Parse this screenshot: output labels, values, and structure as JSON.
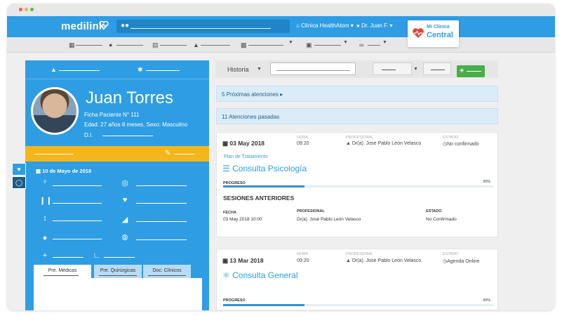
{
  "app": {
    "logo": "medilink",
    "clinic": "Clínica HealthAtom",
    "doctor": "Dr. Juan F.",
    "brand_line1": "Mi Clínica",
    "brand_line2": "Central"
  },
  "colors": {
    "primary": "#2e9de3",
    "warning": "#f5b61b",
    "success": "#49ad48",
    "banner": "#d9ecf8",
    "progress": "#3b8ed0"
  },
  "toolbar_icons": [
    "calendar-icon",
    "users-icon",
    "cart-icon",
    "user-md-icon",
    "documents-icon",
    "chart-icon",
    "link-icon"
  ],
  "patient": {
    "name": "Juan Torres",
    "ficha": "Ficha Paciente N° 111",
    "edad": "Edad: 27 años 8 meses, Sexo: Masculino",
    "di": "D.I.",
    "vitals_date": "10 de Mayo de 2018"
  },
  "left_tabs": {
    "medicas": "Pre. Médicas",
    "quirurgicas": "Pre. Quirúrgicas",
    "clinicos": "Doc. Clínicos"
  },
  "history": {
    "label": "Historia",
    "upcoming": "5 Próximas atenciones ▸",
    "past": "11 Atenciones pasadas"
  },
  "labels": {
    "hora": "HORA",
    "profesional": "PROFESIONAL",
    "estado": "ESTADO",
    "progreso": "PROGRESO",
    "sesiones": "SESIONES ANTERIORES",
    "fecha": "FECHA"
  },
  "appointments": [
    {
      "date": "03 May 2018",
      "hora": "09:20",
      "profesional": "Dr(a). Jose Pablo León Velasco",
      "estado": "No confirmado",
      "plan": "Plan de Tratamiento",
      "title": "Consulta Psicología",
      "progress_pct": "30%",
      "progress": 0.3,
      "session": {
        "fecha": "03 May 2018 10:00",
        "profesional": "Dr(a). José Pablo León Velasco",
        "estado": "No Confirmado"
      }
    },
    {
      "date": "13 Mar 2018",
      "hora": "09:20",
      "profesional": "Dr(a). Jose Pablo León Velasco",
      "estado": "Agenda Online",
      "title": "Consulta General",
      "progress_pct": "30%",
      "progress": 0.3
    }
  ]
}
